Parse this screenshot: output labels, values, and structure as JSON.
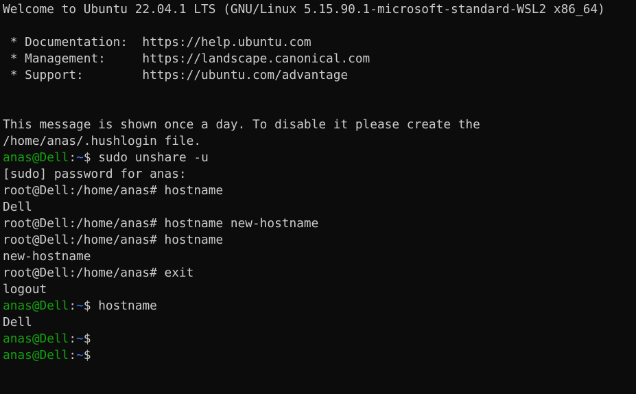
{
  "terminal": {
    "lines": [
      {
        "type": "text",
        "text": "Welcome to Ubuntu 22.04.1 LTS (GNU/Linux 5.15.90.1-microsoft-standard-WSL2 x86_64)"
      },
      {
        "type": "text",
        "text": ""
      },
      {
        "type": "text",
        "text": " * Documentation:  https://help.ubuntu.com"
      },
      {
        "type": "text",
        "text": " * Management:     https://landscape.canonical.com"
      },
      {
        "type": "text",
        "text": " * Support:        https://ubuntu.com/advantage"
      },
      {
        "type": "text",
        "text": ""
      },
      {
        "type": "text",
        "text": ""
      },
      {
        "type": "text",
        "text": "This message is shown once a day. To disable it please create the"
      },
      {
        "type": "text",
        "text": "/home/anas/.hushlogin file."
      },
      {
        "type": "prompt",
        "user": "anas@Dell",
        "sep": ":",
        "path": "~",
        "sym": "$ ",
        "cmd": "sudo unshare -u"
      },
      {
        "type": "text",
        "text": "[sudo] password for anas:"
      },
      {
        "type": "text",
        "text": "root@Dell:/home/anas# hostname"
      },
      {
        "type": "text",
        "text": "Dell"
      },
      {
        "type": "text",
        "text": "root@Dell:/home/anas# hostname new-hostname"
      },
      {
        "type": "text",
        "text": "root@Dell:/home/anas# hostname"
      },
      {
        "type": "text",
        "text": "new-hostname"
      },
      {
        "type": "text",
        "text": "root@Dell:/home/anas# exit"
      },
      {
        "type": "text",
        "text": "logout"
      },
      {
        "type": "prompt",
        "user": "anas@Dell",
        "sep": ":",
        "path": "~",
        "sym": "$ ",
        "cmd": "hostname"
      },
      {
        "type": "text",
        "text": "Dell"
      },
      {
        "type": "prompt",
        "user": "anas@Dell",
        "sep": ":",
        "path": "~",
        "sym": "$",
        "cmd": ""
      },
      {
        "type": "prompt",
        "user": "anas@Dell",
        "sep": ":",
        "path": "~",
        "sym": "$",
        "cmd": ""
      }
    ]
  },
  "colors": {
    "background": "#0c0c0c",
    "foreground": "#cccccc",
    "user_host": "#13a10e",
    "path": "#3b78ff"
  }
}
